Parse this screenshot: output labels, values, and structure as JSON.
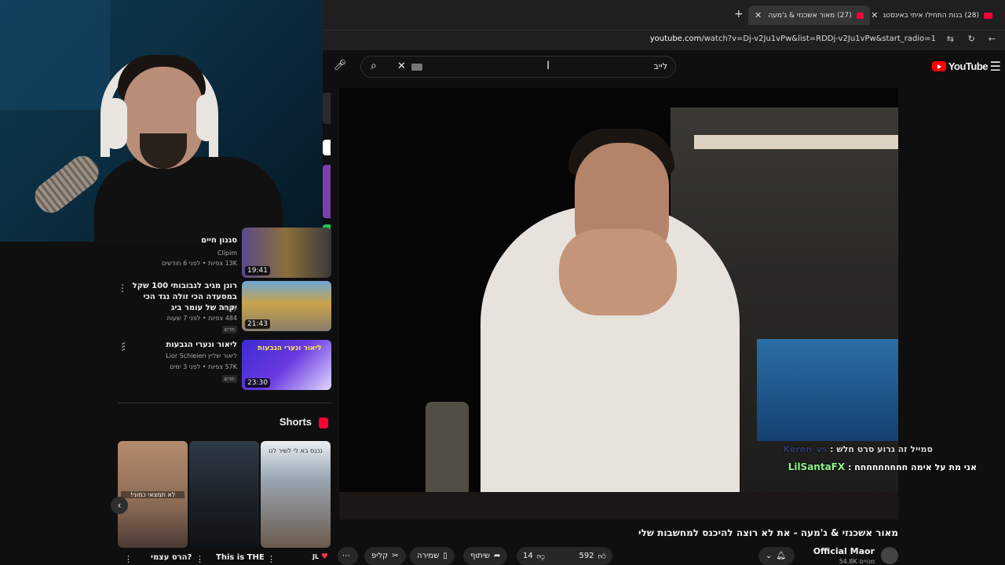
{
  "browser": {
    "tabs": [
      {
        "label": "(28) בנות התחילו איתי באינסטג"
      },
      {
        "label": "(27) מאור אשכנזי & ג'מעה - את"
      }
    ],
    "new_tab": "+",
    "url_domain": "youtube.com",
    "url_path": "/watch?v=Dj-v2Ju1vPw&list=RDDj-v2Ju1vPw&start_radio=1"
  },
  "youtube": {
    "logo_text": "YouTube",
    "search_query": "לייב",
    "brand_color": "#ff0000"
  },
  "video": {
    "title": "מאור אשכנזי & ג'מעה - את לא רוצה להיכנס למחשבות שלי",
    "channel": "Official Maor",
    "subscribers": "54.8K מנויים",
    "likes": "592",
    "dislikes": "14",
    "share_label": "שיתוף",
    "save_label": "שמירה",
    "clip_label": "קליפ"
  },
  "chat": [
    {
      "name": "Keren_vs",
      "message": "סמייל זה גרוע סרט חלש"
    },
    {
      "name": "LilSantaFX",
      "message": "אני מת על אימה חחחחחחחחח"
    }
  ],
  "recommendations": [
    {
      "title": "סגנון חיים",
      "channel": "Clipim",
      "meta": "13K צפיות • לפני 6 חודשים",
      "duration": "19:41",
      "badge": ""
    },
    {
      "title": "רונן מגיב לגבובותי 100 שקל במסעדה הכי זולה נגד הכי יקרה של עומר ביג",
      "channel": "Zepry",
      "meta": "484 צפיות • לפני 7 שעות",
      "duration": "21:43",
      "badge": "חדש"
    },
    {
      "title": "ליאור ונערי הגבעות",
      "channel": "ליאור שליין Lior Schleien",
      "meta": "57K צפיות • לפני 3 ימים",
      "duration": "23:30",
      "badge": "חדש"
    }
  ],
  "thumb_text": {
    "rec3": "ליאור ונערי הגבעות",
    "short1": "לא תמצאי כמוני!",
    "short3": "נכנס בא לי לשיר לנו"
  },
  "shorts": {
    "heading": "Shorts",
    "items": [
      {
        "title": "הרס עצמי?"
      },
      {
        "title": "This is THE"
      },
      {
        "title": "JL"
      }
    ]
  }
}
